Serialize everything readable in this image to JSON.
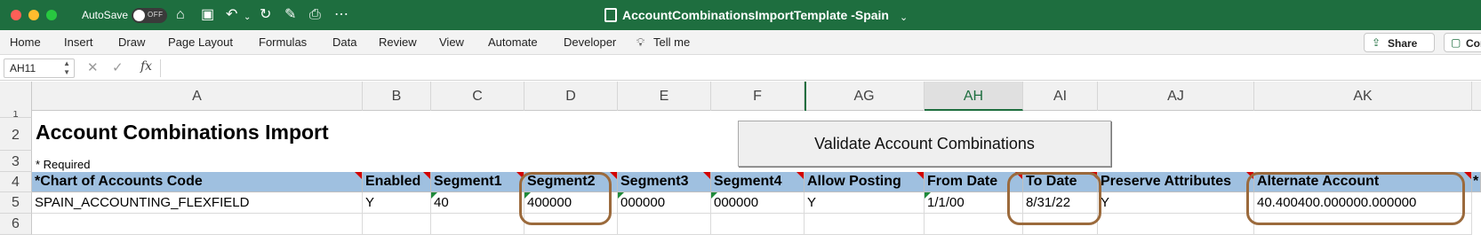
{
  "titlebar": {
    "autosave_label": "AutoSave",
    "toggle_state": "OFF",
    "doc_title": "AccountCombinationsImportTemplate -Spain",
    "title_chevron": "⌄",
    "colors": {
      "bar": "#1e6e3f"
    }
  },
  "ribbon": {
    "tabs": [
      "Home",
      "Insert",
      "Draw",
      "Page Layout",
      "Formulas",
      "Data",
      "Review",
      "View",
      "Automate",
      "Developer",
      "Tell me"
    ],
    "share_label": "Share",
    "comments_label": "Comm"
  },
  "formula_bar": {
    "name_box": "AH11",
    "fx": "fx",
    "formula": ""
  },
  "grid": {
    "columns": [
      "A",
      "B",
      "C",
      "D",
      "E",
      "F",
      "AG",
      "AH",
      "AI",
      "AJ",
      "AK"
    ],
    "selected_column": "AH",
    "rows": [
      "1",
      "2",
      "3",
      "4",
      "5",
      "6"
    ],
    "sheet_title": "Account Combinations Import",
    "required_note": "* Required",
    "headers": [
      "*Chart of Accounts Code",
      "Enabled",
      "Segment1",
      "Segment2",
      "Segment3",
      "Segment4",
      "Allow Posting",
      "From Date",
      "To Date",
      "Preserve Attributes",
      "Alternate Account",
      "*"
    ],
    "row5": [
      "SPAIN_ACCOUNTING_FLEXFIELD",
      "Y",
      "40",
      "400000",
      "000000",
      "000000",
      "Y",
      "1/1/00",
      "8/31/22",
      "Y",
      "40.400400.000000.000000"
    ],
    "validate_button": "Validate Account Combinations",
    "highlight_color": "#9b6a3c",
    "header_fill": "#9fc0e0"
  }
}
